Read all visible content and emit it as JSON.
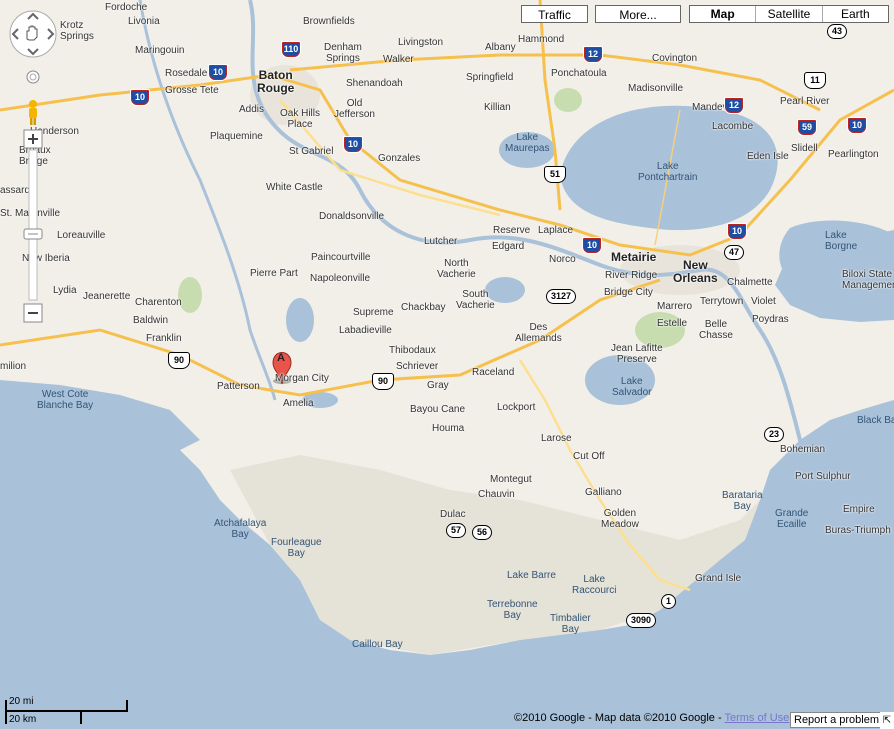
{
  "map_type_buttons": {
    "traffic": "Traffic",
    "more": "More...",
    "map": "Map",
    "satellite": "Satellite",
    "earth": "Earth",
    "active": "Map"
  },
  "marker": {
    "label": "A",
    "color": "#e8534a"
  },
  "colors": {
    "water": "#a9c1d9",
    "land": "#f2efe9",
    "park": "#c7ddb0",
    "urban": "#e8e4db",
    "highway": "#f6c04d",
    "major_road": "#fcdf8f"
  },
  "places": {
    "fordoche": "Fordoche",
    "livonia": "Livonia",
    "brownfields": "Brownfields",
    "hammond": "Hammond",
    "maringouin": "Maringouin",
    "krotz_springs": "Krotz\nSprings",
    "denham_springs": "Denham\nSprings",
    "livingston": "Livingston",
    "albany": "Albany",
    "covington": "Covington",
    "rosedale": "Rosedale",
    "grosse_tete": "Grosse Tete",
    "baton_rouge": "Baton\nRouge",
    "walker": "Walker",
    "shenandoah": "Shenandoah",
    "springfield": "Springfield",
    "ponchatoula": "Ponchatoula",
    "madisonville": "Madisonville",
    "mandeville": "Mandeville",
    "pearl_river": "Pearl River",
    "addis": "Addis",
    "oak_hills_place": "Oak Hills\nPlace",
    "old_jefferson": "Old\nJefferson",
    "killian": "Killian",
    "lacombe": "Lacombe",
    "eden_isle": "Eden Isle",
    "slidell": "Slidell",
    "pearlington": "Pearlington",
    "henderson": "Henderson",
    "plaquemine": "Plaquemine",
    "lake_maurepas": "Lake\nMaurepas",
    "st_gabriel": "St Gabriel",
    "gonzales": "Gonzales",
    "breaux_bridge": "Breaux\nBridge",
    "lake_pontchartrain": "Lake\nPontchartrain",
    "white_castle": "White Castle",
    "assard": "assard",
    "st_martinville": "St. Martinville",
    "donaldsonville": "Donaldsonville",
    "loreauville": "Loreauville",
    "paincourtville": "Paincourtville",
    "lutcher": "Lutcher",
    "reserve": "Reserve",
    "laplace": "Laplace",
    "edgard": "Edgard",
    "metairie": "Metairie",
    "lake_borgne": "Lake\nBorgne",
    "new_iberia": "New Iberia",
    "norco": "Norco",
    "new_orleans": "New\nOrleans",
    "chalmette": "Chalmette",
    "biloxi_state": "Biloxi State\nManagemen",
    "pierre_part": "Pierre Part",
    "north_vacherie": "North\nVacherie",
    "napoleonville": "Napoleonville",
    "river_ridge": "River Ridge",
    "lydia": "Lydia",
    "jeanerette": "Jeanerette",
    "charenton": "Charenton",
    "south_vacherie": "South\nVacherie",
    "bridge_city": "Bridge City",
    "marrero": "Marrero",
    "terrytown": "Terrytown",
    "violet": "Violet",
    "baldwin": "Baldwin",
    "chackbay": "Chackbay",
    "supreme": "Supreme",
    "labadieville": "Labadieville",
    "des_allemands": "Des\nAllemands",
    "estelle": "Estelle",
    "belle_chasse": "Belle\nChasse",
    "poydras": "Poydras",
    "franklin": "Franklin",
    "thibodaux": "Thibodaux",
    "jean_lafitte": "Jean Lafitte\nPreserve",
    "schriever": "Schriever",
    "raceland": "Raceland",
    "milion": "milion",
    "morgan_city": "Morgan City",
    "patterson": "Patterson",
    "gray": "Gray",
    "lake_salvador": "Lake\nSalvador",
    "west_cote_blanche_bay": "West Cote\nBlanche Bay",
    "amelia": "Amelia",
    "bayou_cane": "Bayou Cane",
    "lockport": "Lockport",
    "black_bay": "Black Bay",
    "houma": "Houma",
    "larose": "Larose",
    "bohemian": "Bohemian",
    "cut_off": "Cut Off",
    "montegut": "Montegut",
    "port_sulphur": "Port Sulphur",
    "chauvin": "Chauvin",
    "galliano": "Galliano",
    "barataria_bay": "Barataria\nBay",
    "empire": "Empire",
    "golden_meadow": "Golden\nMeadow",
    "grande_ecaille": "Grande\nEcaille",
    "atchafalaya_bay": "Atchafalaya\nBay",
    "dulac": "Dulac",
    "buras_triumph": "Buras-Triumph",
    "fourleague_bay": "Fourleague\nBay",
    "lake_barre": "Lake Barre",
    "grand_isle": "Grand Isle",
    "lake_raccourci": "Lake\nRaccourci",
    "terrebonne_bay": "Terrebonne\nBay",
    "timbalier_bay": "Timbalier\nBay",
    "caillou_bay": "Caillou Bay"
  },
  "shields": {
    "i110": "110",
    "i12_a": "12",
    "i12_b": "12",
    "i10_a": "10",
    "i10_b": "10",
    "i10_c": "10",
    "i10_d": "10",
    "i10_e": "10",
    "i10_f": "10",
    "i10_g": "10",
    "i59": "59",
    "us51": "51",
    "us11": "11",
    "us90_a": "90",
    "us90_b": "90",
    "la43": "43",
    "la47": "47",
    "la3127": "3127",
    "la23": "23",
    "la57": "57",
    "la56": "56",
    "la1": "1",
    "la3090": "3090"
  },
  "scale": {
    "miles": "20 mi",
    "km": "20 km"
  },
  "footer": {
    "copyright": "©2010 Google - Map data ©2010 Google - ",
    "terms": "Terms of Use",
    "report": "Report a problem"
  }
}
